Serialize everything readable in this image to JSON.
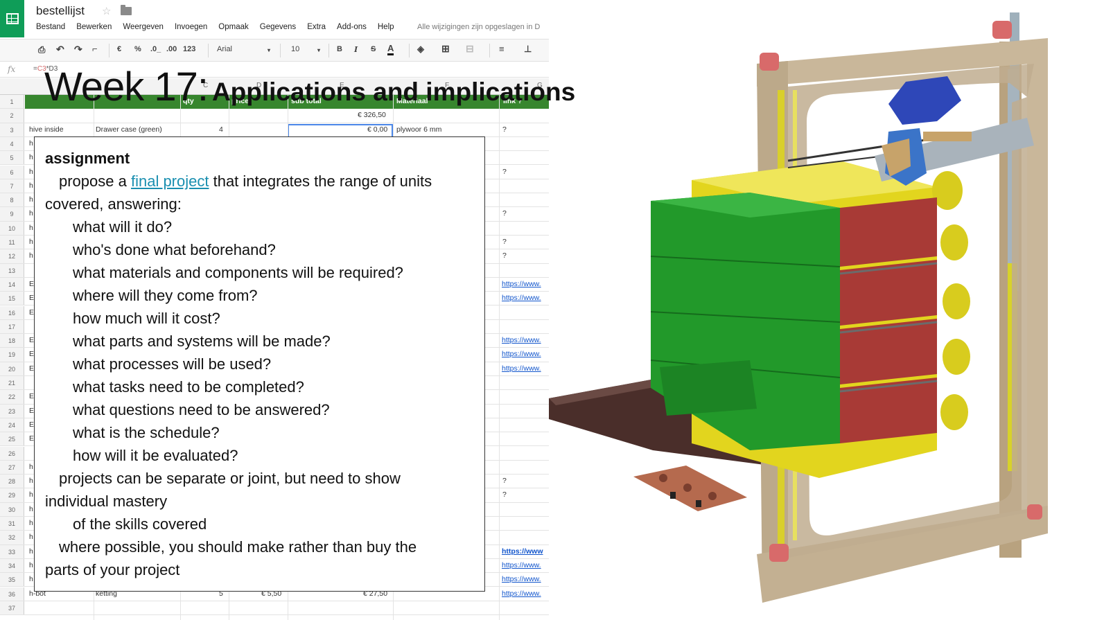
{
  "spreadsheet": {
    "doc_title": "bestellijst",
    "menu": [
      "Bestand",
      "Bewerken",
      "Weergeven",
      "Invoegen",
      "Opmaak",
      "Gegevens",
      "Extra",
      "Add-ons",
      "Help"
    ],
    "save_status": "Alle wijzigingen zijn opgeslagen in D",
    "toolbar": {
      "currency": "€",
      "percent": "%",
      "decimal_less": ".0_",
      "decimal_more": ".00",
      "number_format": "123",
      "font": "Arial",
      "font_size": "10",
      "bold": "B",
      "italic": "I",
      "strike": "S",
      "text_color": "A"
    },
    "formula": {
      "prefix": "=",
      "a": "C3",
      "op": "*",
      "b": "D3"
    },
    "columns": {
      "c": "C",
      "d": "D",
      "e": "E",
      "f": "F",
      "g": "G"
    },
    "header_row": {
      "qty": "qty",
      "price": "price",
      "sub_total": "sub total",
      "material": "Materiaal",
      "link": "link ?"
    },
    "row_numbers": [
      "1",
      "2",
      "3",
      "4",
      "5",
      "6",
      "7",
      "8",
      "9",
      "10",
      "11",
      "12",
      "13",
      "14",
      "15",
      "16",
      "17",
      "18",
      "19",
      "20",
      "21",
      "22",
      "23",
      "24",
      "25",
      "26",
      "27",
      "28",
      "29",
      "30",
      "31",
      "32",
      "33",
      "34",
      "35",
      "36",
      "37"
    ],
    "cells": {
      "r2_total": "€ 326,50",
      "r3_a": "hive inside",
      "r3_b": "Drawer case (green)",
      "r3_c": "4",
      "r3_e": "€ 0,00",
      "r3_f": "plywoor 6 mm",
      "r3_g": "?",
      "r36_a": "h-bot",
      "r36_b": "ketting",
      "r36_c": "5",
      "r36_d": "€ 5,50",
      "r36_e": "€ 27,50"
    },
    "left_letters": {
      "h": "h",
      "e": "E"
    },
    "question": "?",
    "link_text": "https://www.",
    "link_text_bold": "https://www"
  },
  "slide": {
    "week": "Week 17:",
    "topic": "Applications and implications"
  },
  "assignment": {
    "heading": "assignment",
    "intro_before": "propose a ",
    "intro_link": "final project",
    "intro_after": " that integrates the range of units",
    "intro_cont": "covered, answering:",
    "questions": [
      "what will it do?",
      "who's done what beforehand?",
      "what materials and components will be required?",
      "where will they come from?",
      "how much will it cost?",
      "what parts and systems will be made?",
      "what processes will be used?",
      "what tasks need to be completed?",
      "what questions need to be answered?",
      "what is the schedule?",
      "how will it be evaluated?"
    ],
    "joint_1": "projects can be separate or joint, but need to show",
    "joint_2": "individual mastery",
    "joint_3": "of the skills covered",
    "make_1": "where possible, you should make rather than buy the",
    "make_2": "parts of your project"
  },
  "colors": {
    "sheets_green": "#0f9d58",
    "header_green": "#37862e",
    "link_blue": "#1155cc",
    "final_project_link": "#1a8fb0",
    "frame_wood": "#c9b79a",
    "drawer_green": "#22992a",
    "drawer_red": "#a83a36",
    "case_yellow": "#e2d51e",
    "gripper_blue": "#2e47b8"
  }
}
